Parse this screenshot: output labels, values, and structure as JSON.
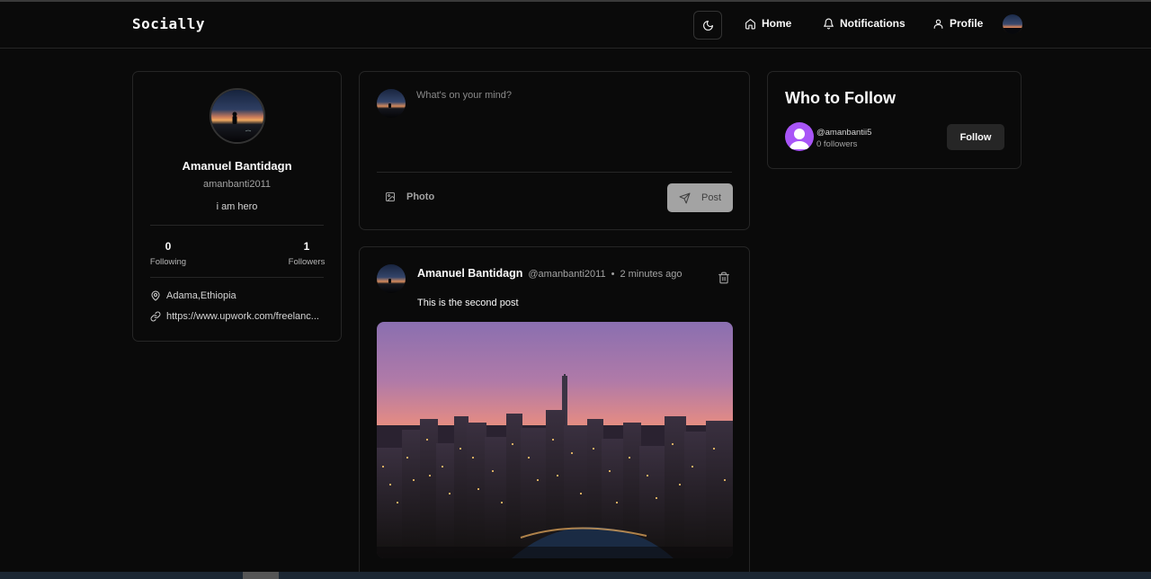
{
  "app": {
    "logo": "Socially"
  },
  "nav": {
    "home_label": "Home",
    "notifications_label": "Notifications",
    "profile_label": "Profile"
  },
  "profile": {
    "name": "Amanuel Bantidagn",
    "username": "amanbanti2011",
    "bio": "i am hero",
    "following_count": "0",
    "following_label": "Following",
    "followers_count": "1",
    "followers_label": "Followers",
    "location": "Adama,Ethiopia",
    "website": "https://www.upwork.com/freelanc..."
  },
  "composer": {
    "placeholder": "What's on your mind?",
    "photo_label": "Photo",
    "post_label": "Post"
  },
  "post": {
    "author": "Amanuel Bantidagn",
    "handle": "@amanbanti2011",
    "separator": "•",
    "time": "2 minutes ago",
    "text": "This is the second post"
  },
  "who_to_follow": {
    "title": "Who to Follow",
    "suggestions": [
      {
        "username": "@amanbantii5",
        "followers": "0 followers",
        "button": "Follow"
      }
    ]
  },
  "colors": {
    "background": "#0a0a0a",
    "border": "#262626",
    "suggestion_avatar": "#a855f7",
    "post_button": "#a3a3a3"
  },
  "icons": [
    "moon-icon",
    "home-icon",
    "bell-icon",
    "user-icon",
    "map-pin-icon",
    "link-icon",
    "image-icon",
    "send-icon",
    "trash-icon"
  ]
}
